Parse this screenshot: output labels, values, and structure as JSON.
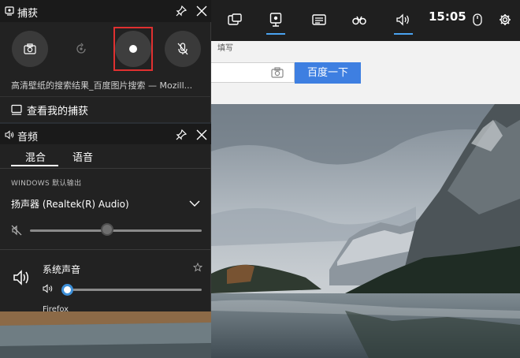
{
  "colors": {
    "accent_blue": "#4aa3f0",
    "record_highlight": "#e03030",
    "widget_bg": "#222222",
    "baidu_button": "#3e7fe1"
  },
  "browser": {
    "label_fragment": "填写",
    "search_button_label": "百度一下",
    "camera_icon": "camera-icon"
  },
  "topbar": {
    "buttons": [
      {
        "icon": "widget-menu-icon",
        "active": false
      },
      {
        "icon": "capture-icon",
        "active": true
      },
      {
        "icon": "performance-icon",
        "active": false
      },
      {
        "icon": "looking-for-group-icon",
        "active": false
      },
      {
        "icon": "audio-icon",
        "active": true
      },
      {
        "icon": "mouse-icon",
        "active": false
      },
      {
        "icon": "gear-icon",
        "active": false
      }
    ],
    "clock": "15:05"
  },
  "capture": {
    "title": "捕获",
    "icons": [
      "capture-widget-icon",
      "pin-icon",
      "close-icon"
    ],
    "buttons": [
      {
        "name": "screenshot",
        "icon": "camera-icon"
      },
      {
        "name": "record-last",
        "icon": "record-last-icon"
      },
      {
        "name": "start-recording",
        "icon": "record-dot-icon"
      },
      {
        "name": "microphone",
        "icon": "mic-off-icon"
      }
    ],
    "source": "高清壁纸的搜索结果_百度图片搜索 — Mozill...",
    "view_captures": "查看我的捕获"
  },
  "audio": {
    "title": "音频",
    "icons": [
      "speaker-icon",
      "pin-icon",
      "close-icon"
    ],
    "tabs": [
      {
        "label": "混合",
        "selected": true
      },
      {
        "label": "语音",
        "selected": false
      }
    ],
    "output_label": "WINDOWS 默认输出",
    "device_name": "扬声器 (Realtek(R) Audio)",
    "master_volume": 45,
    "master_muted": true,
    "system_sounds": {
      "label": "系统声音",
      "volume": 0
    },
    "next_app": "Firefox"
  }
}
